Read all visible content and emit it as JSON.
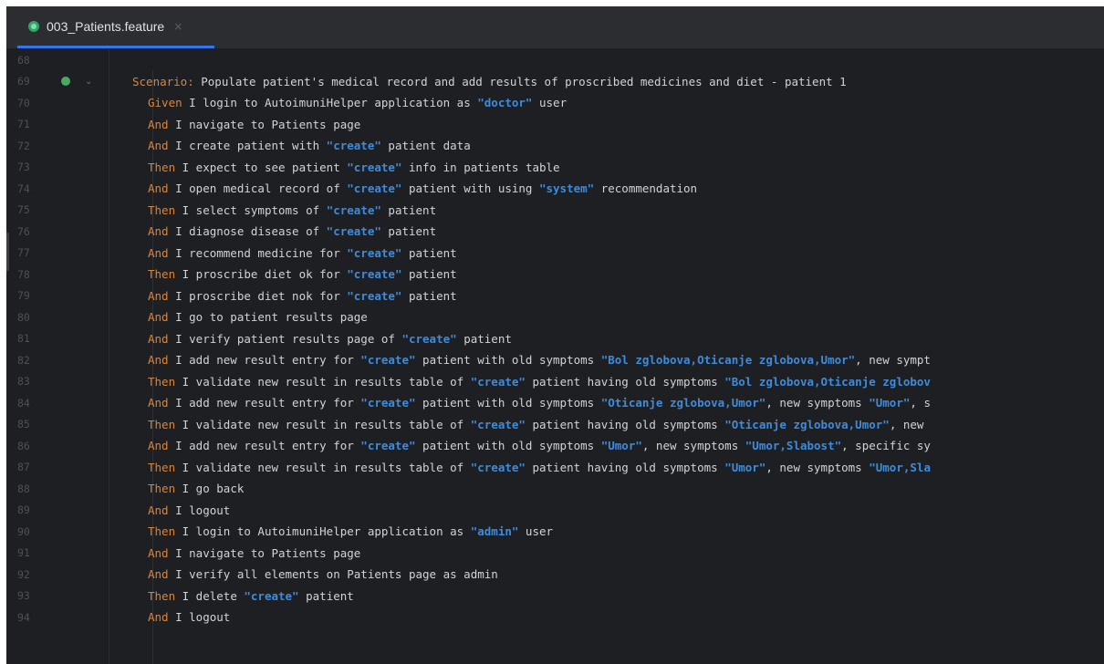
{
  "tab": {
    "label": "003_Patients.feature",
    "close": "×",
    "icon": "cucumber-feature-icon"
  },
  "colors": {
    "keyword": "#d78640",
    "string": "#3f8bdb",
    "text": "#d0d3d8",
    "line_number": "#4b5059",
    "accent": "#3574f0"
  },
  "lines": [
    {
      "n": "68",
      "parts": []
    },
    {
      "n": "69",
      "indent": 0,
      "parts": [
        {
          "t": "kw",
          "v": "Scenario:"
        },
        {
          "t": "plain",
          "v": " Populate patient's medical record and add results of proscribed medicines and diet - patient 1"
        }
      ]
    },
    {
      "n": "70",
      "indent": 1,
      "parts": [
        {
          "t": "kw",
          "v": "Given"
        },
        {
          "t": "plain",
          "v": " I login to AutoimuniHelper application as "
        },
        {
          "t": "str",
          "v": "\"doctor\""
        },
        {
          "t": "plain",
          "v": " user"
        }
      ]
    },
    {
      "n": "71",
      "indent": 1,
      "parts": [
        {
          "t": "kw",
          "v": "And"
        },
        {
          "t": "plain",
          "v": " I navigate to Patients page"
        }
      ]
    },
    {
      "n": "72",
      "indent": 1,
      "parts": [
        {
          "t": "kw",
          "v": "And"
        },
        {
          "t": "plain",
          "v": " I create patient with "
        },
        {
          "t": "str",
          "v": "\"create\""
        },
        {
          "t": "plain",
          "v": " patient data"
        }
      ]
    },
    {
      "n": "73",
      "indent": 1,
      "parts": [
        {
          "t": "kw",
          "v": "Then"
        },
        {
          "t": "plain",
          "v": " I expect to see patient "
        },
        {
          "t": "str",
          "v": "\"create\""
        },
        {
          "t": "plain",
          "v": " info in patients table"
        }
      ]
    },
    {
      "n": "74",
      "indent": 1,
      "parts": [
        {
          "t": "kw",
          "v": "And"
        },
        {
          "t": "plain",
          "v": " I open medical record of "
        },
        {
          "t": "str",
          "v": "\"create\""
        },
        {
          "t": "plain",
          "v": " patient with using "
        },
        {
          "t": "str",
          "v": "\"system\""
        },
        {
          "t": "plain",
          "v": " recommendation"
        }
      ]
    },
    {
      "n": "75",
      "indent": 1,
      "parts": [
        {
          "t": "kw",
          "v": "Then"
        },
        {
          "t": "plain",
          "v": " I select symptoms of "
        },
        {
          "t": "str",
          "v": "\"create\""
        },
        {
          "t": "plain",
          "v": " patient"
        }
      ]
    },
    {
      "n": "76",
      "indent": 1,
      "parts": [
        {
          "t": "kw",
          "v": "And"
        },
        {
          "t": "plain",
          "v": " I diagnose disease of "
        },
        {
          "t": "str",
          "v": "\"create\""
        },
        {
          "t": "plain",
          "v": " patient"
        }
      ]
    },
    {
      "n": "77",
      "indent": 1,
      "parts": [
        {
          "t": "kw",
          "v": "And"
        },
        {
          "t": "plain",
          "v": " I recommend medicine for "
        },
        {
          "t": "str",
          "v": "\"create\""
        },
        {
          "t": "plain",
          "v": " patient"
        }
      ]
    },
    {
      "n": "78",
      "indent": 1,
      "parts": [
        {
          "t": "kw",
          "v": "Then"
        },
        {
          "t": "plain",
          "v": " I proscribe diet ok for "
        },
        {
          "t": "str",
          "v": "\"create\""
        },
        {
          "t": "plain",
          "v": " patient"
        }
      ]
    },
    {
      "n": "79",
      "indent": 1,
      "parts": [
        {
          "t": "kw",
          "v": "And"
        },
        {
          "t": "plain",
          "v": " I proscribe diet nok for "
        },
        {
          "t": "str",
          "v": "\"create\""
        },
        {
          "t": "plain",
          "v": " patient"
        }
      ]
    },
    {
      "n": "80",
      "indent": 1,
      "parts": [
        {
          "t": "kw",
          "v": "And"
        },
        {
          "t": "plain",
          "v": " I go to patient results page"
        }
      ]
    },
    {
      "n": "81",
      "indent": 1,
      "parts": [
        {
          "t": "kw",
          "v": "And"
        },
        {
          "t": "plain",
          "v": " I verify patient results page of "
        },
        {
          "t": "str",
          "v": "\"create\""
        },
        {
          "t": "plain",
          "v": " patient"
        }
      ]
    },
    {
      "n": "82",
      "indent": 1,
      "parts": [
        {
          "t": "kw",
          "v": "And"
        },
        {
          "t": "plain",
          "v": " I add new result entry for "
        },
        {
          "t": "str",
          "v": "\"create\""
        },
        {
          "t": "plain",
          "v": " patient with old symptoms "
        },
        {
          "t": "str",
          "v": "\"Bol zglobova,Oticanje zglobova,Umor\""
        },
        {
          "t": "plain",
          "v": ", new sympt"
        }
      ]
    },
    {
      "n": "83",
      "indent": 1,
      "parts": [
        {
          "t": "kw",
          "v": "Then"
        },
        {
          "t": "plain",
          "v": " I validate new result in results table of "
        },
        {
          "t": "str",
          "v": "\"create\""
        },
        {
          "t": "plain",
          "v": " patient having old symptoms "
        },
        {
          "t": "str",
          "v": "\"Bol zglobova,Oticanje zglobov"
        }
      ]
    },
    {
      "n": "84",
      "indent": 1,
      "parts": [
        {
          "t": "kw",
          "v": "And"
        },
        {
          "t": "plain",
          "v": " I add new result entry for "
        },
        {
          "t": "str",
          "v": "\"create\""
        },
        {
          "t": "plain",
          "v": " patient with old symptoms "
        },
        {
          "t": "str",
          "v": "\"Oticanje zglobova,Umor\""
        },
        {
          "t": "plain",
          "v": ", new symptoms "
        },
        {
          "t": "str",
          "v": "\"Umor\""
        },
        {
          "t": "plain",
          "v": ", s"
        }
      ]
    },
    {
      "n": "85",
      "indent": 1,
      "parts": [
        {
          "t": "kw",
          "v": "Then"
        },
        {
          "t": "plain",
          "v": " I validate new result in results table of "
        },
        {
          "t": "str",
          "v": "\"create\""
        },
        {
          "t": "plain",
          "v": " patient having old symptoms "
        },
        {
          "t": "str",
          "v": "\"Oticanje zglobova,Umor\""
        },
        {
          "t": "plain",
          "v": ", new"
        }
      ]
    },
    {
      "n": "86",
      "indent": 1,
      "parts": [
        {
          "t": "kw",
          "v": "And"
        },
        {
          "t": "plain",
          "v": " I add new result entry for "
        },
        {
          "t": "str",
          "v": "\"create\""
        },
        {
          "t": "plain",
          "v": " patient with old symptoms "
        },
        {
          "t": "str",
          "v": "\"Umor\""
        },
        {
          "t": "plain",
          "v": ", new symptoms "
        },
        {
          "t": "str",
          "v": "\"Umor,Slabost\""
        },
        {
          "t": "plain",
          "v": ", specific sy"
        }
      ]
    },
    {
      "n": "87",
      "indent": 1,
      "parts": [
        {
          "t": "kw",
          "v": "Then"
        },
        {
          "t": "plain",
          "v": " I validate new result in results table of "
        },
        {
          "t": "str",
          "v": "\"create\""
        },
        {
          "t": "plain",
          "v": " patient having old symptoms "
        },
        {
          "t": "str",
          "v": "\"Umor\""
        },
        {
          "t": "plain",
          "v": ", new symptoms "
        },
        {
          "t": "str",
          "v": "\"Umor,Sla"
        }
      ]
    },
    {
      "n": "88",
      "indent": 1,
      "parts": [
        {
          "t": "kw",
          "v": "Then"
        },
        {
          "t": "plain",
          "v": " I go back"
        }
      ]
    },
    {
      "n": "89",
      "indent": 1,
      "parts": [
        {
          "t": "kw",
          "v": "And"
        },
        {
          "t": "plain",
          "v": " I logout"
        }
      ]
    },
    {
      "n": "90",
      "indent": 1,
      "parts": [
        {
          "t": "kw",
          "v": "Then"
        },
        {
          "t": "plain",
          "v": " I login to AutoimuniHelper application as "
        },
        {
          "t": "str",
          "v": "\"admin\""
        },
        {
          "t": "plain",
          "v": " user"
        }
      ]
    },
    {
      "n": "91",
      "indent": 1,
      "parts": [
        {
          "t": "kw",
          "v": "And"
        },
        {
          "t": "plain",
          "v": " I navigate to Patients page"
        }
      ]
    },
    {
      "n": "92",
      "indent": 1,
      "parts": [
        {
          "t": "kw",
          "v": "And"
        },
        {
          "t": "plain",
          "v": " I verify all elements on Patients page as admin"
        }
      ]
    },
    {
      "n": "93",
      "indent": 1,
      "parts": [
        {
          "t": "kw",
          "v": "Then"
        },
        {
          "t": "plain",
          "v": " I delete "
        },
        {
          "t": "str",
          "v": "\"create\""
        },
        {
          "t": "plain",
          "v": " patient"
        }
      ]
    },
    {
      "n": "94",
      "indent": 1,
      "parts": [
        {
          "t": "kw",
          "v": "And"
        },
        {
          "t": "plain",
          "v": " I logout"
        }
      ]
    }
  ]
}
